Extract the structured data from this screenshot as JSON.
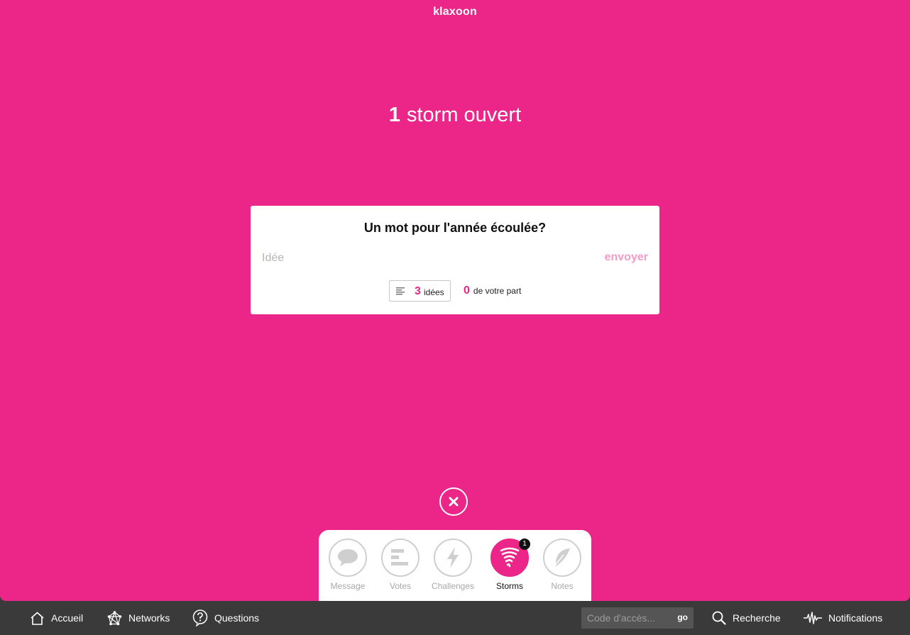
{
  "brand": {
    "logo": "klaxoon"
  },
  "header": {
    "count": "1",
    "text": "storm ouvert"
  },
  "storm": {
    "question": "Un mot pour l'année écoulée?",
    "input_placeholder": "Idée",
    "send_label": "envoyer",
    "ideas_count": "3",
    "ideas_label": "idées",
    "mine_count": "0",
    "mine_label": "de votre part"
  },
  "tools": [
    {
      "label": "Message",
      "icon": "speech-bubble-icon"
    },
    {
      "label": "Votes",
      "icon": "bars-icon"
    },
    {
      "label": "Challenges",
      "icon": "lightning-icon"
    },
    {
      "label": "Storms",
      "icon": "tornado-icon",
      "badge": "1",
      "active": true
    },
    {
      "label": "Notes",
      "icon": "feather-icon"
    }
  ],
  "bottom_nav": {
    "home": "Accueil",
    "networks": "Networks",
    "questions": "Questions",
    "code_placeholder": "Code d'accès...",
    "go": "go",
    "search": "Recherche",
    "notifications": "Notifications"
  },
  "colors": {
    "brand_pink": "#ec2588",
    "bar_dark": "#3a3a3a"
  }
}
